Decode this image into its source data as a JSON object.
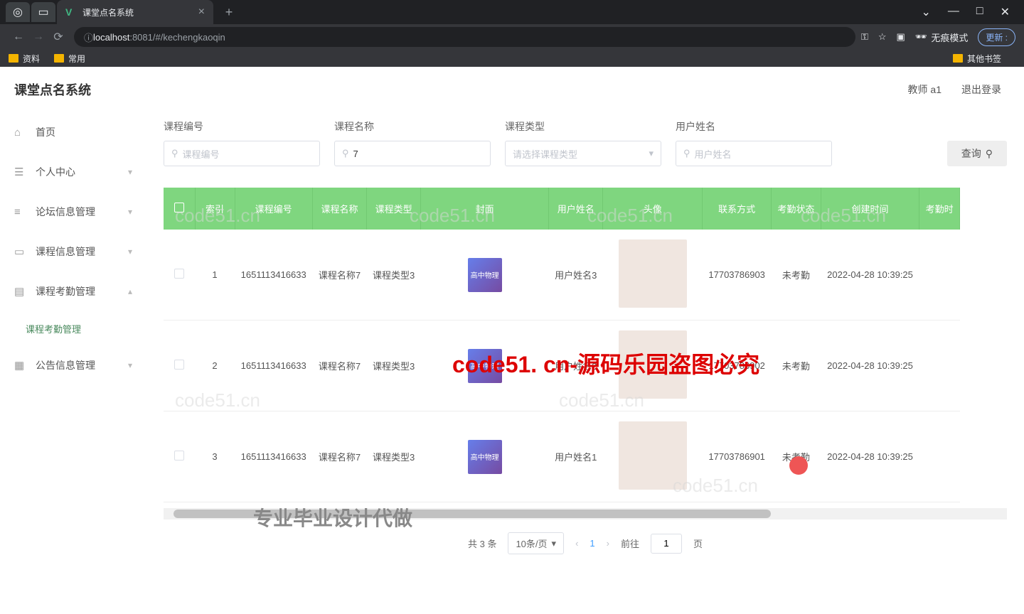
{
  "browser": {
    "tab_title": "课堂点名系统",
    "url_host": "localhost",
    "url_path": ":8081/#/kechengkaoqin",
    "incognito_label": "无痕模式",
    "update_label": "更新 :",
    "bookmarks": [
      "资料",
      "常用"
    ],
    "other_bookmarks": "其他书签"
  },
  "app": {
    "logo": "课堂点名系统",
    "user_label": "教师 a1",
    "logout": "退出登录"
  },
  "sidebar": {
    "items": [
      {
        "icon": "⌂",
        "label": "首页"
      },
      {
        "icon": "☰",
        "label": "个人中心",
        "chev": "▾"
      },
      {
        "icon": "≡",
        "label": "论坛信息管理",
        "chev": "▾"
      },
      {
        "icon": "▭",
        "label": "课程信息管理",
        "chev": "▾"
      },
      {
        "icon": "▤",
        "label": "课程考勤管理",
        "chev": "▴"
      },
      {
        "icon": "",
        "label": "课程考勤管理",
        "sub": true
      },
      {
        "icon": "▦",
        "label": "公告信息管理",
        "chev": "▾"
      }
    ]
  },
  "filters": {
    "f1_label": "课程编号",
    "f1_ph": "课程编号",
    "f2_label": "课程名称",
    "f2_val": "7",
    "f3_label": "课程类型",
    "f3_ph": "请选择课程类型",
    "f4_label": "用户姓名",
    "f4_ph": "用户姓名",
    "search": "查询"
  },
  "table": {
    "headers": [
      "",
      "索引",
      "课程编号",
      "课程名称",
      "课程类型",
      "封面",
      "用户姓名",
      "头像",
      "联系方式",
      "考勤状态",
      "创建时间",
      "考勤时"
    ],
    "rows": [
      {
        "idx": "1",
        "code": "1651113416633",
        "name": "课程名称7",
        "type": "课程类型3",
        "cover": "高中物理",
        "user": "用户姓名3",
        "phone": "17703786903",
        "status": "未考勤",
        "time": "2022-04-28 10:39:25"
      },
      {
        "idx": "2",
        "code": "1651113416633",
        "name": "课程名称7",
        "type": "课程类型3",
        "cover": "高中物理",
        "user": "用户姓名2",
        "phone": "17703786902",
        "status": "未考勤",
        "time": "2022-04-28 10:39:25"
      },
      {
        "idx": "3",
        "code": "1651113416633",
        "name": "课程名称7",
        "type": "课程类型3",
        "cover": "高中物理",
        "user": "用户姓名1",
        "phone": "17703786901",
        "status": "未考勤",
        "time": "2022-04-28 10:39:25"
      }
    ]
  },
  "pagination": {
    "total": "共 3 条",
    "per_page": "10条/页",
    "current": "1",
    "goto": "前往",
    "page_val": "1",
    "page_suffix": "页"
  },
  "overlays": {
    "red": "code51. cn-源码乐园盗图必究",
    "gray": "专业毕业设计代做",
    "wm": "code51.cn"
  }
}
